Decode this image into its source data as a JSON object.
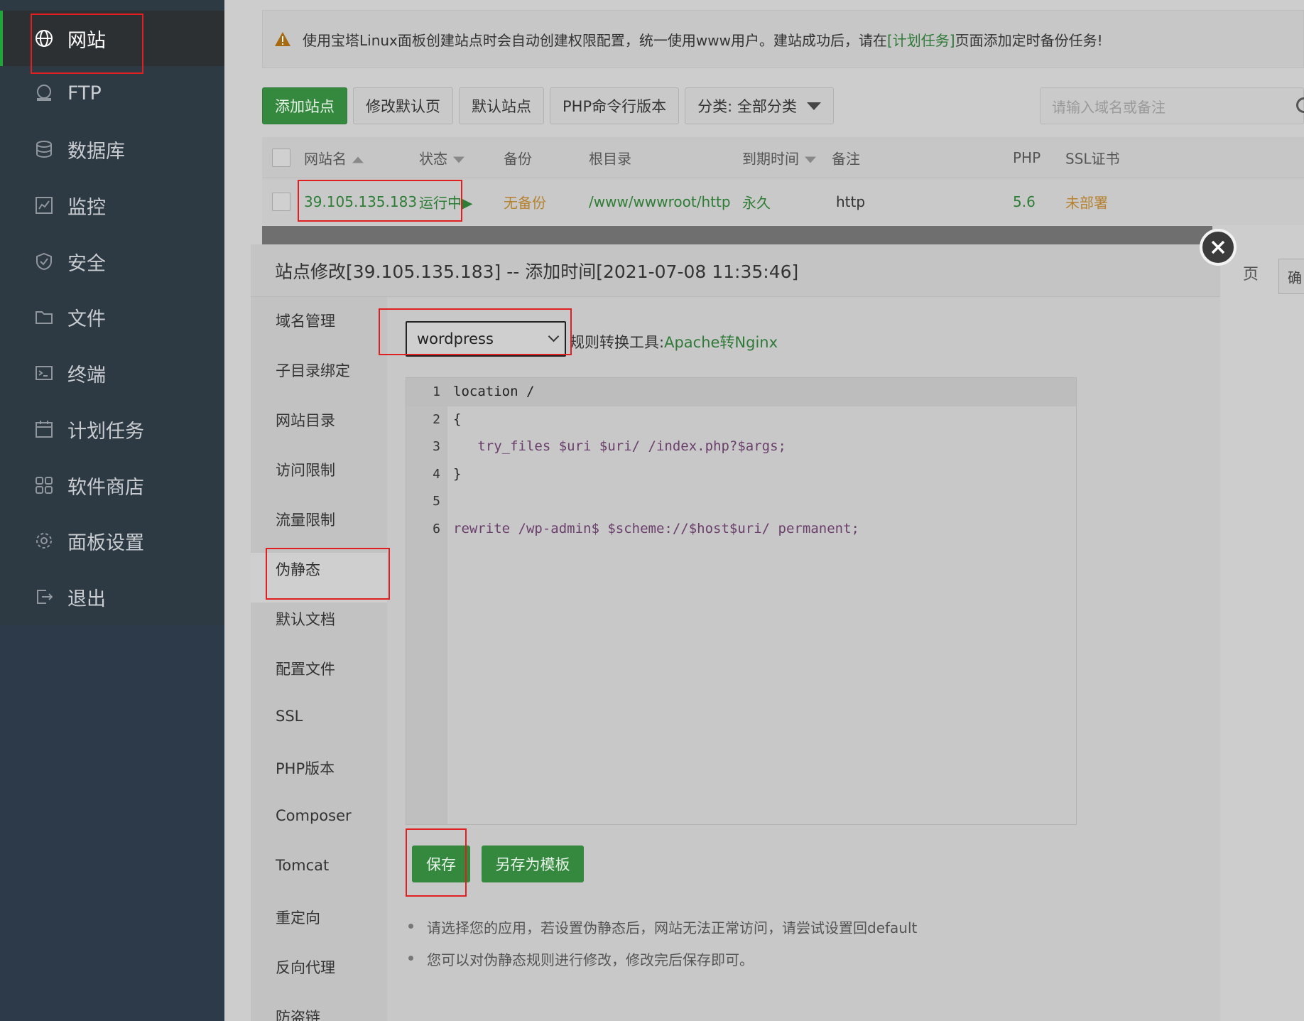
{
  "sidebar": {
    "items": [
      {
        "label": "网站",
        "icon": "globe-icon"
      },
      {
        "label": "FTP",
        "icon": "ftp-icon"
      },
      {
        "label": "数据库",
        "icon": "database-icon"
      },
      {
        "label": "监控",
        "icon": "monitor-icon"
      },
      {
        "label": "安全",
        "icon": "shield-icon"
      },
      {
        "label": "文件",
        "icon": "folder-icon"
      },
      {
        "label": "终端",
        "icon": "terminal-icon"
      },
      {
        "label": "计划任务",
        "icon": "calendar-icon"
      },
      {
        "label": "软件商店",
        "icon": "grid-icon"
      },
      {
        "label": "面板设置",
        "icon": "gear-icon"
      },
      {
        "label": "退出",
        "icon": "logout-icon"
      }
    ]
  },
  "notice": {
    "text_before": "使用宝塔Linux面板创建站点时会自动创建权限配置，统一使用www用户。建站成功后，请在",
    "link": "[计划任务]",
    "text_after": "页面添加定时备份任务!"
  },
  "toolbar": {
    "add_site": "添加站点",
    "edit_default_page": "修改默认页",
    "default_site": "默认站点",
    "php_cli": "PHP命令行版本",
    "category": "分类: 全部分类",
    "search_placeholder": "请输入域名或备注"
  },
  "table": {
    "headers": {
      "name": "网站名",
      "status": "状态",
      "backup": "备份",
      "root": "根目录",
      "expire": "到期时间",
      "remark": "备注",
      "php": "PHP",
      "ssl": "SSL证书"
    },
    "row": {
      "name": "39.105.135.183",
      "status": "运行中▶",
      "backup": "无备份",
      "root": "/www/wwwroot/http",
      "expire": "永久",
      "remark": "http",
      "php": "5.6",
      "ssl": "未部署"
    }
  },
  "pager": {
    "page_label": "页",
    "confirm": "确"
  },
  "modal": {
    "title": "站点修改[39.105.135.183] -- 添加时间[2021-07-08 11:35:46]",
    "tabs": [
      "域名管理",
      "子目录绑定",
      "网站目录",
      "访问限制",
      "流量限制",
      "伪静态",
      "默认文档",
      "配置文件",
      "SSL",
      "PHP版本",
      "Composer",
      "Tomcat",
      "重定向",
      "反向代理",
      "防盗链"
    ],
    "active_tab": "伪静态",
    "select_value": "wordpress",
    "tool_label": "规则转换工具:",
    "tool_link": "Apache转Nginx",
    "code_lines": [
      {
        "n": "1",
        "text": "location /"
      },
      {
        "n": "2",
        "text": "{"
      },
      {
        "n": "3",
        "text": "   try_files $uri $uri/ /index.php?$args;"
      },
      {
        "n": "4",
        "text": "}"
      },
      {
        "n": "5",
        "text": ""
      },
      {
        "n": "6",
        "text": "rewrite /wp-admin$ $scheme://$host$uri/ permanent;"
      }
    ],
    "save_label": "保存",
    "save_template_label": "另存为模板",
    "tips": [
      "请选择您的应用，若设置伪静态后，网站无法正常访问，请尝试设置回default",
      "您可以对伪静态规则进行修改，修改完后保存即可。"
    ]
  },
  "colors": {
    "brand_green": "#20a53a",
    "highlight_red": "#e02020"
  }
}
